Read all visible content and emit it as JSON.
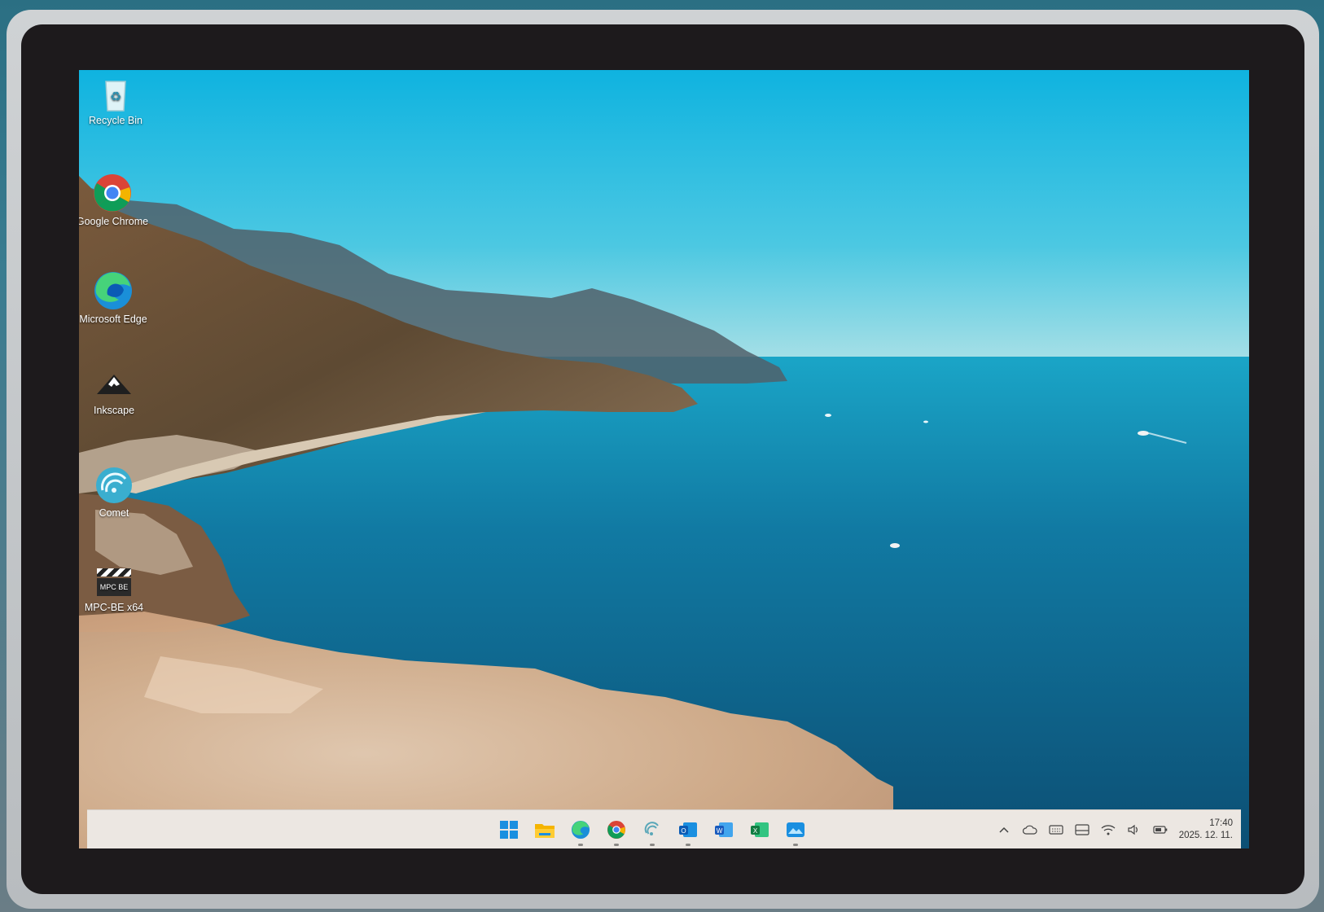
{
  "desktop": {
    "icons": [
      {
        "label": "Recycle Bin",
        "icon": "recycle-bin-icon"
      },
      {
        "label": "Google Chrome",
        "icon": "chrome-icon"
      },
      {
        "label": "Microsoft Edge",
        "icon": "edge-icon"
      },
      {
        "label": "Inkscape",
        "icon": "inkscape-icon"
      },
      {
        "label": "Comet",
        "icon": "comet-icon"
      },
      {
        "label": "MPC-BE x64",
        "icon": "mpc-be-icon"
      }
    ],
    "mpc_badge": "MPC BE"
  },
  "taskbar": {
    "pinned": [
      {
        "name": "Start",
        "icon": "windows-start-icon"
      },
      {
        "name": "File Explorer",
        "icon": "file-explorer-icon"
      },
      {
        "name": "Microsoft Edge",
        "icon": "edge-icon"
      },
      {
        "name": "Google Chrome",
        "icon": "chrome-icon"
      },
      {
        "name": "Comet",
        "icon": "comet-icon"
      },
      {
        "name": "Outlook",
        "icon": "outlook-icon"
      },
      {
        "name": "Word",
        "icon": "word-icon"
      },
      {
        "name": "Excel",
        "icon": "excel-icon"
      },
      {
        "name": "Photos",
        "icon": "photos-icon"
      }
    ],
    "tray": {
      "icons": [
        "chevron-up-icon",
        "onedrive-icon",
        "keyboard-icon",
        "tablet-icon",
        "wifi-icon",
        "volume-icon",
        "battery-icon"
      ],
      "time": "17:40",
      "date": "2025. 12. 11."
    }
  },
  "colors": {
    "sky": "#1ab8dc",
    "sea": "#10688f",
    "taskbar": "#ece7e2"
  }
}
